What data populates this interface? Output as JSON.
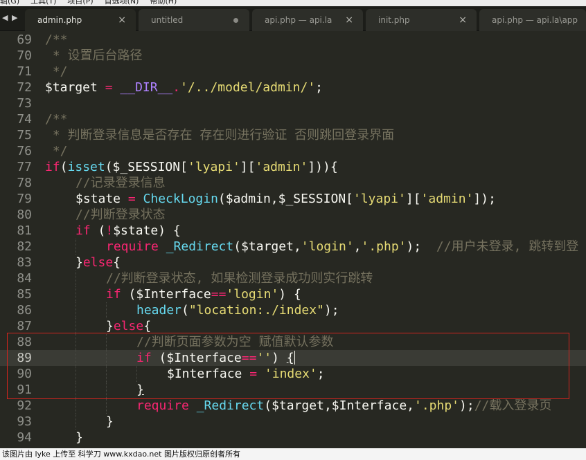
{
  "menubar": {
    "items": [
      "辑(G)",
      "工具(T)",
      "项目(P)",
      "首选项(N)",
      "帮助(H)"
    ]
  },
  "tabs": [
    {
      "label": "admin.php",
      "active": true,
      "state": "close"
    },
    {
      "label": "untitled",
      "active": false,
      "state": "dirty"
    },
    {
      "label": "api.php — api.la",
      "active": false,
      "state": "close"
    },
    {
      "label": "init.php",
      "active": false,
      "state": "close"
    },
    {
      "label": "api.php — api.la\\app",
      "active": false,
      "state": "close"
    }
  ],
  "tab_icons": {
    "close": "×",
    "nav": "◀ ▶"
  },
  "editor": {
    "current_line": 89,
    "lines": [
      {
        "num": "69",
        "indent": 0,
        "tokens": [
          {
            "t": "c",
            "x": "/**"
          }
        ]
      },
      {
        "num": "70",
        "indent": 0,
        "tokens": [
          {
            "t": "c",
            "x": " * 设置后台路径"
          }
        ]
      },
      {
        "num": "71",
        "indent": 0,
        "tokens": [
          {
            "t": "c",
            "x": " */"
          }
        ]
      },
      {
        "num": "72",
        "indent": 0,
        "tokens": [
          {
            "t": "v",
            "x": "$target "
          },
          {
            "t": "o",
            "x": "="
          },
          {
            "t": "v",
            "x": " "
          },
          {
            "t": "cn",
            "x": "__DIR__"
          },
          {
            "t": "o",
            "x": "."
          },
          {
            "t": "s",
            "x": "'/../model/admin/'"
          },
          {
            "t": "v",
            "x": ";"
          }
        ]
      },
      {
        "num": "73",
        "indent": 0,
        "tokens": []
      },
      {
        "num": "74",
        "indent": 0,
        "tokens": [
          {
            "t": "c",
            "x": "/**"
          }
        ]
      },
      {
        "num": "75",
        "indent": 0,
        "tokens": [
          {
            "t": "c",
            "x": " * 判断登录信息是否存在 存在则进行验证 否则跳回登录界面"
          }
        ]
      },
      {
        "num": "76",
        "indent": 0,
        "tokens": [
          {
            "t": "c",
            "x": " */"
          }
        ]
      },
      {
        "num": "77",
        "indent": 0,
        "tokens": [
          {
            "t": "k",
            "x": "if"
          },
          {
            "t": "v",
            "x": "("
          },
          {
            "t": "f",
            "x": "isset"
          },
          {
            "t": "v",
            "x": "($_SESSION["
          },
          {
            "t": "s",
            "x": "'lyapi'"
          },
          {
            "t": "v",
            "x": "]["
          },
          {
            "t": "s",
            "x": "'admin'"
          },
          {
            "t": "v",
            "x": "])){"
          }
        ]
      },
      {
        "num": "78",
        "indent": 1,
        "tokens": [
          {
            "t": "c",
            "x": "//记录登录信息"
          }
        ]
      },
      {
        "num": "79",
        "indent": 1,
        "tokens": [
          {
            "t": "v",
            "x": "$state "
          },
          {
            "t": "o",
            "x": "="
          },
          {
            "t": "v",
            "x": " "
          },
          {
            "t": "f",
            "x": "CheckLogin"
          },
          {
            "t": "v",
            "x": "($admin,$_SESSION["
          },
          {
            "t": "s",
            "x": "'lyapi'"
          },
          {
            "t": "v",
            "x": "]["
          },
          {
            "t": "s",
            "x": "'admin'"
          },
          {
            "t": "v",
            "x": "]);"
          }
        ]
      },
      {
        "num": "80",
        "indent": 1,
        "tokens": [
          {
            "t": "c",
            "x": "//判断登录状态"
          }
        ]
      },
      {
        "num": "81",
        "indent": 1,
        "tokens": [
          {
            "t": "k",
            "x": "if"
          },
          {
            "t": "v",
            "x": " ("
          },
          {
            "t": "o",
            "x": "!"
          },
          {
            "t": "v",
            "x": "$state) {"
          }
        ]
      },
      {
        "num": "82",
        "indent": 2,
        "tokens": [
          {
            "t": "k",
            "x": "require"
          },
          {
            "t": "v",
            "x": " "
          },
          {
            "t": "f",
            "x": "_Redirect"
          },
          {
            "t": "v",
            "x": "($target,"
          },
          {
            "t": "s",
            "x": "'login'"
          },
          {
            "t": "v",
            "x": ","
          },
          {
            "t": "s",
            "x": "'.php'"
          },
          {
            "t": "v",
            "x": ");  "
          },
          {
            "t": "c",
            "x": "//用户未登录, 跳转到登"
          }
        ]
      },
      {
        "num": "83",
        "indent": 1,
        "tokens": [
          {
            "t": "v",
            "x": "}"
          },
          {
            "t": "k",
            "x": "else"
          },
          {
            "t": "v",
            "x": "{"
          }
        ]
      },
      {
        "num": "84",
        "indent": 2,
        "tokens": [
          {
            "t": "c",
            "x": "//判断登录状态, 如果检测登录成功则实行跳转"
          }
        ]
      },
      {
        "num": "85",
        "indent": 2,
        "tokens": [
          {
            "t": "k",
            "x": "if"
          },
          {
            "t": "v",
            "x": " ($Interface"
          },
          {
            "t": "o",
            "x": "=="
          },
          {
            "t": "s",
            "x": "'login'"
          },
          {
            "t": "v",
            "x": ") {"
          }
        ]
      },
      {
        "num": "86",
        "indent": 3,
        "tokens": [
          {
            "t": "f",
            "x": "header"
          },
          {
            "t": "v",
            "x": "("
          },
          {
            "t": "s",
            "x": "\"location:./index\""
          },
          {
            "t": "v",
            "x": ");"
          }
        ]
      },
      {
        "num": "87",
        "indent": 2,
        "tokens": [
          {
            "t": "v",
            "x": "}"
          },
          {
            "t": "k",
            "x": "else"
          },
          {
            "t": "v",
            "x": "{"
          }
        ]
      },
      {
        "num": "88",
        "indent": 3,
        "tokens": [
          {
            "t": "c",
            "x": "//判断页面参数为空 赋值默认参数"
          }
        ]
      },
      {
        "num": "89",
        "indent": 3,
        "tokens": [
          {
            "t": "k",
            "x": "if"
          },
          {
            "t": "v",
            "x": " ($Interface"
          },
          {
            "t": "o",
            "x": "=="
          },
          {
            "t": "s",
            "x": "''"
          },
          {
            "t": "v",
            "x": ") "
          },
          {
            "t": "u",
            "x": "{"
          }
        ]
      },
      {
        "num": "90",
        "indent": 4,
        "tokens": [
          {
            "t": "v",
            "x": "$Interface "
          },
          {
            "t": "o",
            "x": "="
          },
          {
            "t": "v",
            "x": " "
          },
          {
            "t": "s",
            "x": "'index'"
          },
          {
            "t": "v",
            "x": ";"
          }
        ]
      },
      {
        "num": "91",
        "indent": 3,
        "tokens": [
          {
            "t": "u",
            "x": "}"
          }
        ]
      },
      {
        "num": "92",
        "indent": 3,
        "tokens": [
          {
            "t": "k",
            "x": "require"
          },
          {
            "t": "v",
            "x": " "
          },
          {
            "t": "f",
            "x": "_Redirect"
          },
          {
            "t": "v",
            "x": "($target,$Interface,"
          },
          {
            "t": "s",
            "x": "'.php'"
          },
          {
            "t": "v",
            "x": ");"
          },
          {
            "t": "c",
            "x": "//载入登录页"
          }
        ]
      },
      {
        "num": "93",
        "indent": 2,
        "tokens": [
          {
            "t": "v",
            "x": "}"
          }
        ]
      },
      {
        "num": "94",
        "indent": 1,
        "tokens": [
          {
            "t": "v",
            "x": "}"
          }
        ]
      }
    ]
  },
  "watermark": "该图片由 lyke 上传至 科学刀 www.kxdao.net 图片版权归原创者所有",
  "colors": {
    "background": "#272822",
    "comment": "#75715e",
    "keyword": "#f92672",
    "string": "#e6db74",
    "function": "#66d9ef",
    "constant": "#ae81ff",
    "annotation_box": "#d2251e"
  }
}
